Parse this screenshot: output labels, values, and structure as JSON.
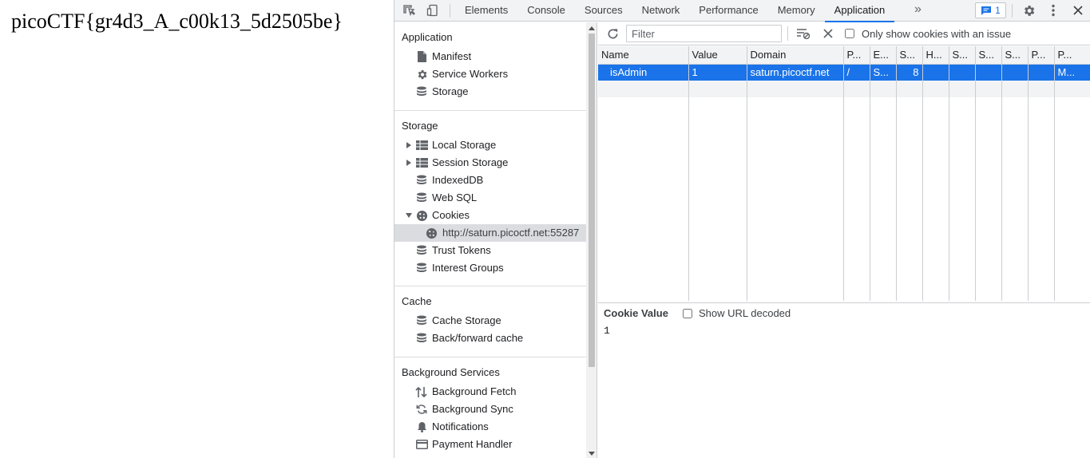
{
  "page": {
    "flag_text": "picoCTF{gr4d3_A_c00k13_5d2505be}"
  },
  "devtools": {
    "tabs": [
      {
        "label": "Elements"
      },
      {
        "label": "Console"
      },
      {
        "label": "Sources"
      },
      {
        "label": "Network"
      },
      {
        "label": "Performance"
      },
      {
        "label": "Memory"
      },
      {
        "label": "Application"
      }
    ],
    "active_tab": "Application",
    "more_tabs_icon": "chevron-double-right-icon",
    "issues_count": "1",
    "accent_color": "#1a73e8"
  },
  "sidebar": {
    "application": {
      "title": "Application",
      "items": [
        {
          "label": "Manifest",
          "icon": "document-icon"
        },
        {
          "label": "Service Workers",
          "icon": "gear-icon"
        },
        {
          "label": "Storage",
          "icon": "database-icon"
        }
      ]
    },
    "storage": {
      "title": "Storage",
      "items": [
        {
          "label": "Local Storage",
          "icon": "grid-icon"
        },
        {
          "label": "Session Storage",
          "icon": "grid-icon"
        },
        {
          "label": "IndexedDB",
          "icon": "database-icon"
        },
        {
          "label": "Web SQL",
          "icon": "database-icon"
        },
        {
          "label": "Cookies",
          "icon": "cookie-icon"
        },
        {
          "label": "http://saturn.picoctf.net:55287",
          "icon": "cookie-icon"
        },
        {
          "label": "Trust Tokens",
          "icon": "database-icon"
        },
        {
          "label": "Interest Groups",
          "icon": "database-icon"
        }
      ]
    },
    "cache": {
      "title": "Cache",
      "items": [
        {
          "label": "Cache Storage",
          "icon": "database-icon"
        },
        {
          "label": "Back/forward cache",
          "icon": "database-icon"
        }
      ]
    },
    "background": {
      "title": "Background Services",
      "items": [
        {
          "label": "Background Fetch",
          "icon": "arrows-up-down-icon"
        },
        {
          "label": "Background Sync",
          "icon": "sync-icon"
        },
        {
          "label": "Notifications",
          "icon": "bell-icon"
        },
        {
          "label": "Payment Handler",
          "icon": "card-icon"
        }
      ]
    }
  },
  "toolbar": {
    "filter_placeholder": "Filter",
    "only_issues_label": "Only show cookies with an issue"
  },
  "cookie_table": {
    "headers": [
      "Name",
      "Value",
      "Domain",
      "P...",
      "E...",
      "S...",
      "H...",
      "S...",
      "S...",
      "S...",
      "P...",
      "P..."
    ],
    "rows": [
      {
        "name": "isAdmin",
        "value": "1",
        "domain": "saturn.picoctf.net",
        "path": "/",
        "expires": "S...",
        "size": "8",
        "httponly": "",
        "secure": "",
        "samesite": "",
        "sameparty": "",
        "partition": "",
        "priority": "M..."
      }
    ]
  },
  "cookie_value": {
    "title": "Cookie Value",
    "show_decoded_label": "Show URL decoded",
    "value": "1"
  }
}
